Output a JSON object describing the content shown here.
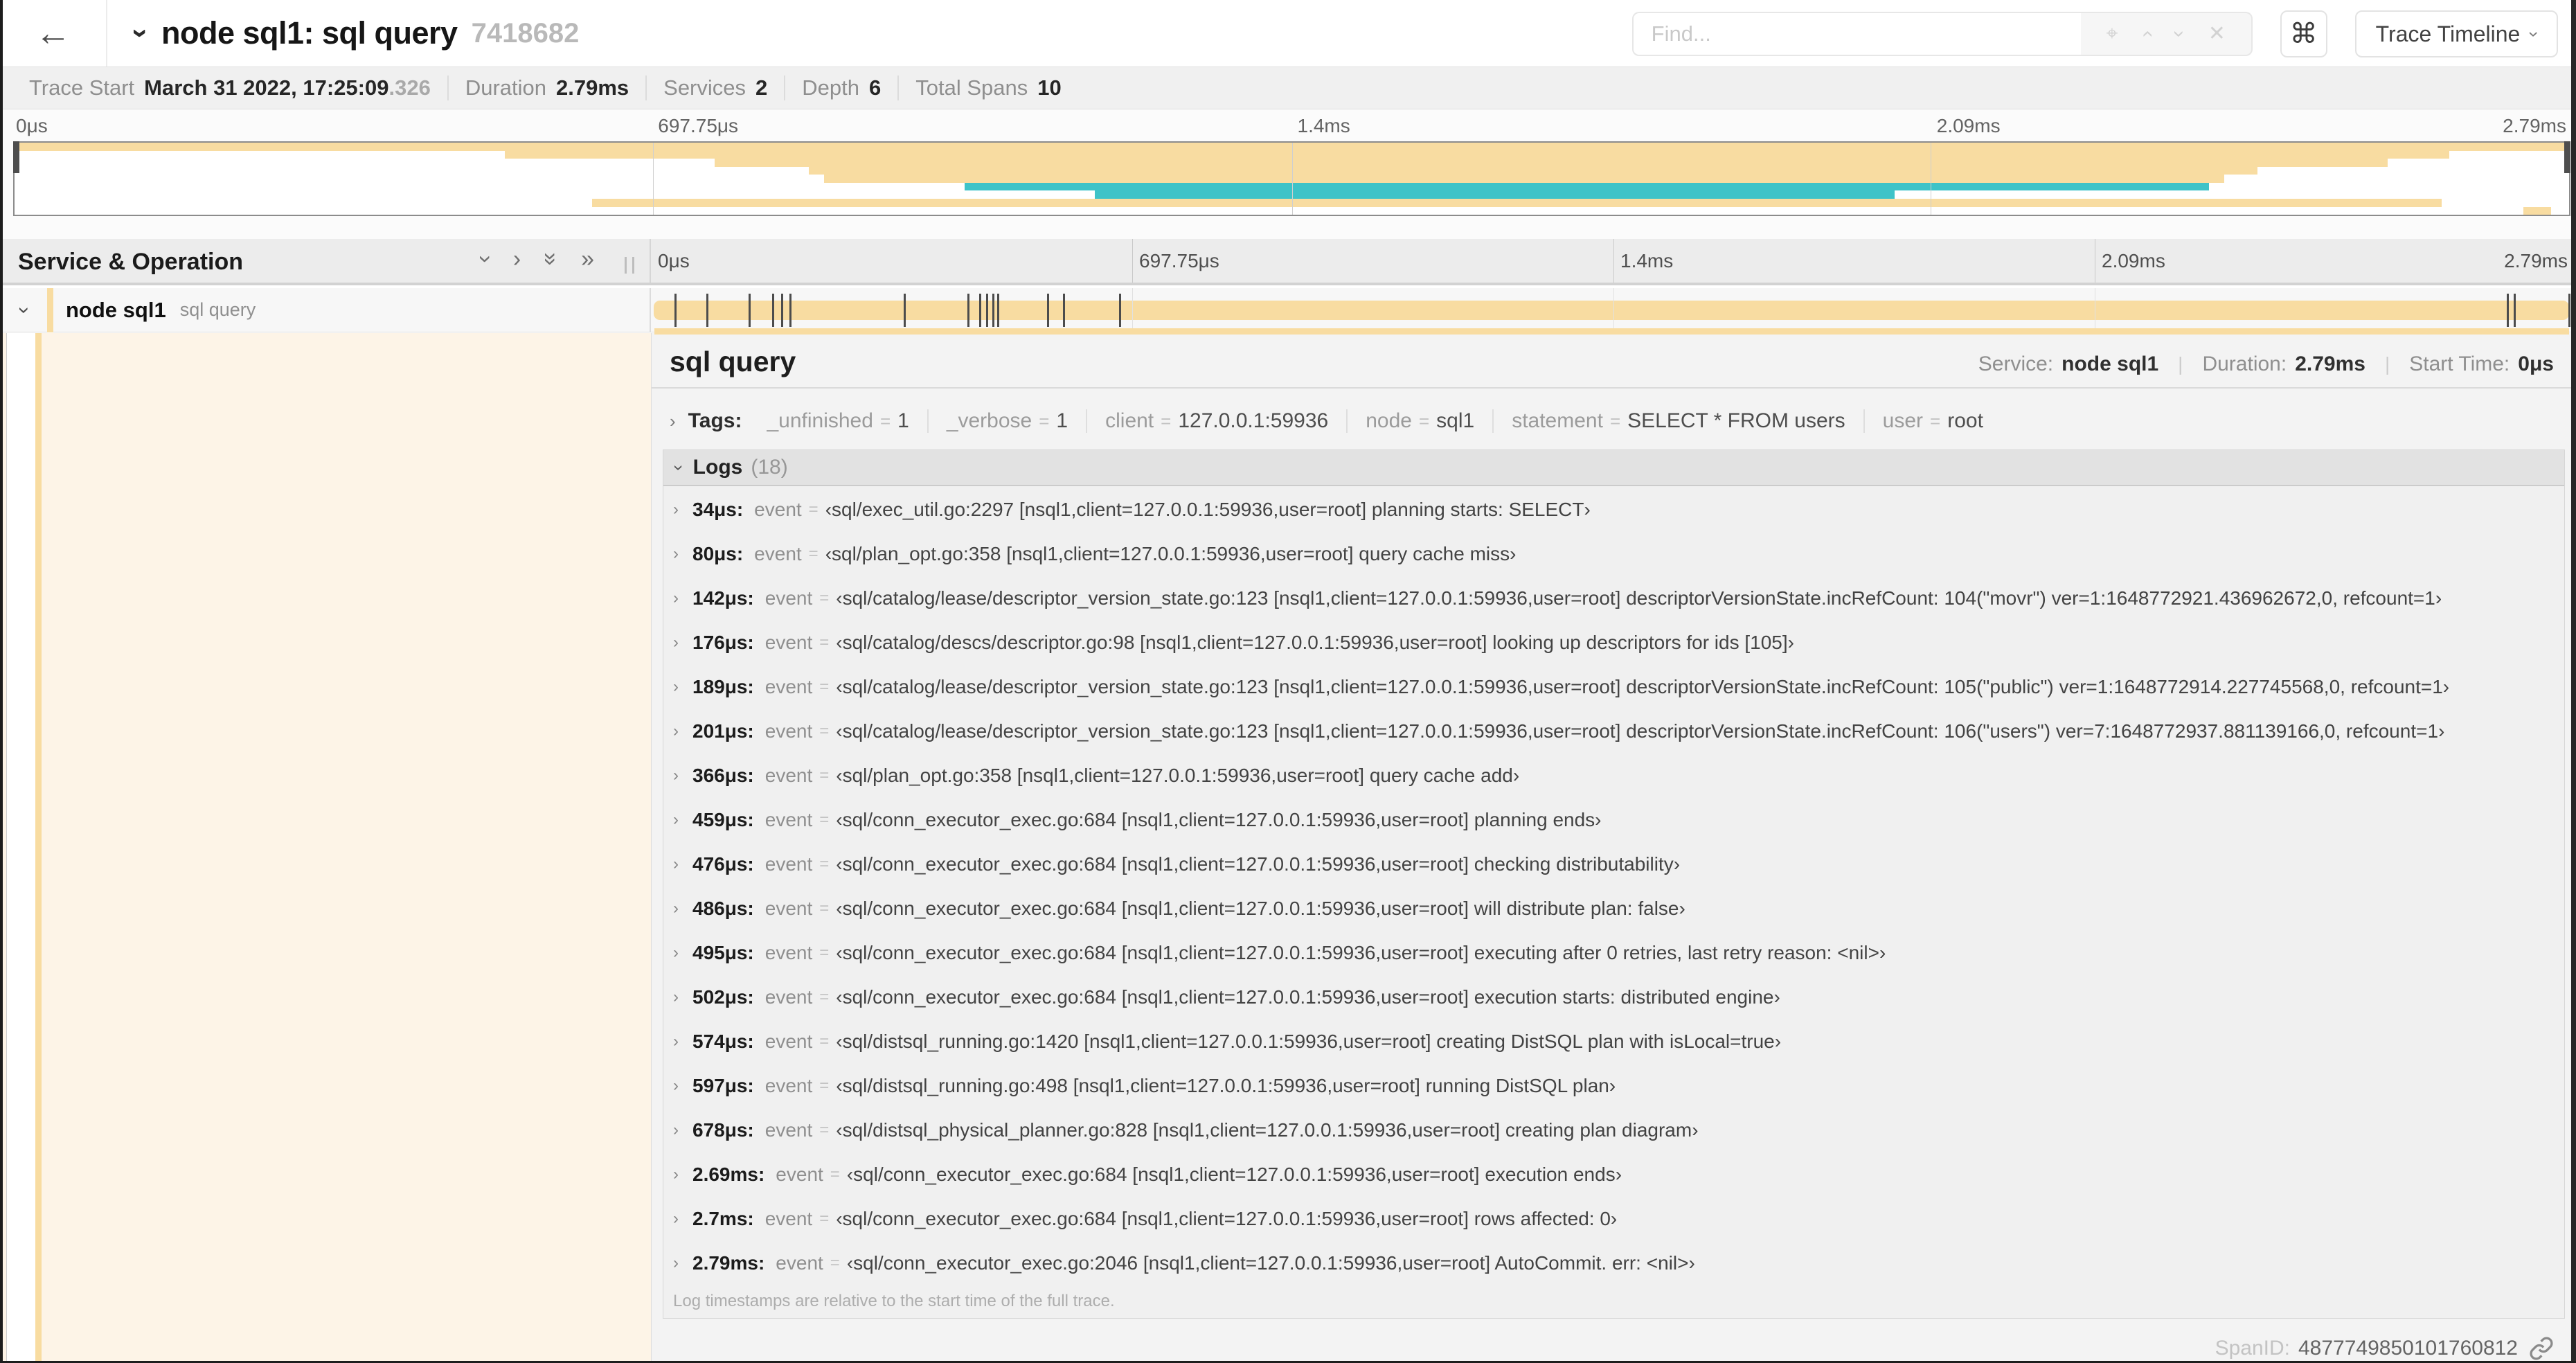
{
  "header": {
    "back_icon": "←",
    "title": "node sql1: sql query",
    "trace_id": "7418682",
    "find_placeholder": "Find...",
    "nav_icons": [
      "locate-icon",
      "prev-result-icon",
      "next-result-icon",
      "clear-icon"
    ],
    "shortcut_icon": "⌘",
    "view_button_label": "Trace Timeline"
  },
  "metadata": {
    "items": [
      {
        "label": "Trace Start",
        "value": "March 31 2022, 17:25:09",
        "suffix": ".326"
      },
      {
        "label": "Duration",
        "value": "2.79ms",
        "suffix": ""
      },
      {
        "label": "Services",
        "value": "2",
        "suffix": ""
      },
      {
        "label": "Depth",
        "value": "6",
        "suffix": ""
      },
      {
        "label": "Total Spans",
        "value": "10",
        "suffix": ""
      }
    ]
  },
  "timeline": {
    "header_label": "Service & Operation",
    "duration_us": 2790,
    "ticks": [
      {
        "label": "0μs",
        "pos": 0
      },
      {
        "label": "697.75μs",
        "pos": 25
      },
      {
        "label": "1.4ms",
        "pos": 50
      },
      {
        "label": "2.09ms",
        "pos": 75
      },
      {
        "label": "2.79ms",
        "pos": 100
      }
    ],
    "colors": {
      "tan": "#F8DCA1",
      "teal": "#3EC3C8"
    },
    "minimap_rows": [
      {
        "start": 0,
        "end": 100,
        "color": "tan"
      },
      {
        "start": 19.2,
        "end": 95.3,
        "color": "tan"
      },
      {
        "start": 27.4,
        "end": 92.9,
        "color": "tan"
      },
      {
        "start": 31.1,
        "end": 87.8,
        "color": "tan"
      },
      {
        "start": 31.7,
        "end": 86.5,
        "color": "tan"
      },
      {
        "start": 37.2,
        "end": 85.9,
        "color": "teal"
      },
      {
        "start": 42.3,
        "end": 73.6,
        "color": "teal"
      },
      {
        "start": 22.6,
        "end": 95.0,
        "color": "tan"
      },
      {
        "start": 98.2,
        "end": 99.3,
        "color": "tan"
      }
    ]
  },
  "span": {
    "service": "node sql1",
    "operation": "sql query",
    "marker_times_us": [
      34,
      80,
      142,
      176,
      189,
      201,
      366,
      459,
      476,
      486,
      495,
      502,
      574,
      597,
      678,
      2690,
      2700,
      2790
    ]
  },
  "detail": {
    "title": "sql query",
    "service_label": "Service:",
    "service": "node sql1",
    "duration_label": "Duration:",
    "duration": "2.79ms",
    "start_label": "Start Time:",
    "start": "0μs",
    "tags_label": "Tags:",
    "tags": [
      {
        "key": "_unfinished",
        "value": "1"
      },
      {
        "key": "_verbose",
        "value": "1"
      },
      {
        "key": "client",
        "value": "127.0.0.1:59936"
      },
      {
        "key": "node",
        "value": "sql1"
      },
      {
        "key": "statement",
        "value": "SELECT * FROM users"
      },
      {
        "key": "user",
        "value": "root"
      }
    ],
    "logs_label": "Logs",
    "logs_count": "(18)",
    "logs": [
      {
        "time": "34μs:",
        "key": "event",
        "value": "sql/exec_util.go:2297 [nsql1,client=127.0.0.1:59936,user=root] planning starts: SELECT"
      },
      {
        "time": "80μs:",
        "key": "event",
        "value": "sql/plan_opt.go:358 [nsql1,client=127.0.0.1:59936,user=root] query cache miss"
      },
      {
        "time": "142μs:",
        "key": "event",
        "value": "sql/catalog/lease/descriptor_version_state.go:123 [nsql1,client=127.0.0.1:59936,user=root] descriptorVersionState.incRefCount: 104(\"movr\") ver=1:1648772921.436962672,0, refcount=1"
      },
      {
        "time": "176μs:",
        "key": "event",
        "value": "sql/catalog/descs/descriptor.go:98 [nsql1,client=127.0.0.1:59936,user=root] looking up descriptors for ids [105]"
      },
      {
        "time": "189μs:",
        "key": "event",
        "value": "sql/catalog/lease/descriptor_version_state.go:123 [nsql1,client=127.0.0.1:59936,user=root] descriptorVersionState.incRefCount: 105(\"public\") ver=1:1648772914.227745568,0, refcount=1"
      },
      {
        "time": "201μs:",
        "key": "event",
        "value": "sql/catalog/lease/descriptor_version_state.go:123 [nsql1,client=127.0.0.1:59936,user=root] descriptorVersionState.incRefCount: 106(\"users\") ver=7:1648772937.881139166,0, refcount=1"
      },
      {
        "time": "366μs:",
        "key": "event",
        "value": "sql/plan_opt.go:358 [nsql1,client=127.0.0.1:59936,user=root] query cache add"
      },
      {
        "time": "459μs:",
        "key": "event",
        "value": "sql/conn_executor_exec.go:684 [nsql1,client=127.0.0.1:59936,user=root] planning ends"
      },
      {
        "time": "476μs:",
        "key": "event",
        "value": "sql/conn_executor_exec.go:684 [nsql1,client=127.0.0.1:59936,user=root] checking distributability"
      },
      {
        "time": "486μs:",
        "key": "event",
        "value": "sql/conn_executor_exec.go:684 [nsql1,client=127.0.0.1:59936,user=root] will distribute plan: false"
      },
      {
        "time": "495μs:",
        "key": "event",
        "value": "sql/conn_executor_exec.go:684 [nsql1,client=127.0.0.1:59936,user=root] executing after 0 retries, last retry reason: <nil>"
      },
      {
        "time": "502μs:",
        "key": "event",
        "value": "sql/conn_executor_exec.go:684 [nsql1,client=127.0.0.1:59936,user=root] execution starts: distributed engine"
      },
      {
        "time": "574μs:",
        "key": "event",
        "value": "sql/distsql_running.go:1420 [nsql1,client=127.0.0.1:59936,user=root] creating DistSQL plan with isLocal=true"
      },
      {
        "time": "597μs:",
        "key": "event",
        "value": "sql/distsql_running.go:498 [nsql1,client=127.0.0.1:59936,user=root] running DistSQL plan"
      },
      {
        "time": "678μs:",
        "key": "event",
        "value": "sql/distsql_physical_planner.go:828 [nsql1,client=127.0.0.1:59936,user=root] creating plan diagram"
      },
      {
        "time": "2.69ms:",
        "key": "event",
        "value": "sql/conn_executor_exec.go:684 [nsql1,client=127.0.0.1:59936,user=root] execution ends"
      },
      {
        "time": "2.7ms:",
        "key": "event",
        "value": "sql/conn_executor_exec.go:684 [nsql1,client=127.0.0.1:59936,user=root] rows affected: 0"
      },
      {
        "time": "2.79ms:",
        "key": "event",
        "value": "sql/conn_executor_exec.go:2046 [nsql1,client=127.0.0.1:59936,user=root] AutoCommit. err: <nil>"
      }
    ],
    "logs_note": "Log timestamps are relative to the start time of the full trace.",
    "spanid_label": "SpanID:",
    "spanid": "4877749850101760812"
  }
}
